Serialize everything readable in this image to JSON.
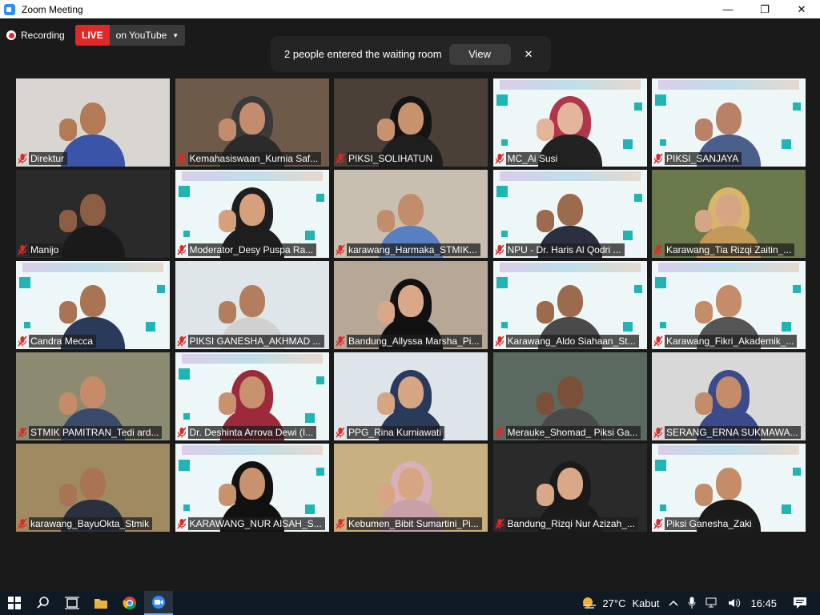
{
  "window": {
    "title": "Zoom Meeting",
    "minimize": "—",
    "maximize": "❐",
    "close": "✕"
  },
  "recording": {
    "label": "Recording"
  },
  "live": {
    "badge": "LIVE",
    "platform": "on YouTube"
  },
  "waiting_room": {
    "message": "2 people entered the waiting room",
    "view_label": "View",
    "close_label": "✕"
  },
  "participants": [
    {
      "name": "Direktur",
      "bg": "#d9d6d2",
      "banner": false,
      "skin": "#b27a55",
      "shirt": "#3a55a8",
      "hijab": ""
    },
    {
      "name": "Kemahasiswaan_Kurnia Saf...",
      "bg": "#6e5a48",
      "banner": false,
      "skin": "#c48c6e",
      "shirt": "#2b2b2b",
      "hijab": "#3a3a3a"
    },
    {
      "name": "PIKSI_SOLIHATUN",
      "bg": "#4a4038",
      "banner": false,
      "skin": "#c9926e",
      "shirt": "#1e1e1e",
      "hijab": "#141414"
    },
    {
      "name": "MC_Ai Susi",
      "bg": "#eef7f7",
      "banner": true,
      "skin": "#e4b59a",
      "shirt": "#222",
      "hijab": "#b0364c"
    },
    {
      "name": "PIKSI_SANJAYA",
      "bg": "#eef7f7",
      "banner": true,
      "skin": "#b98266",
      "shirt": "#4a5f8c",
      "hijab": ""
    },
    {
      "name": "Manijo",
      "bg": "#2a2a2a",
      "banner": false,
      "skin": "#8c5e44",
      "shirt": "#1a1a1a",
      "hijab": ""
    },
    {
      "name": "Moderator_Desy Puspa Ra...",
      "bg": "#eef7f7",
      "banner": true,
      "skin": "#d6a07c",
      "shirt": "#1e1e1e",
      "hijab": "#1e1e1e"
    },
    {
      "name": "karawang_Harmaka_STMIK...",
      "bg": "#c9bfb0",
      "banner": false,
      "skin": "#c28d6c",
      "shirt": "#5a7fc0",
      "hijab": ""
    },
    {
      "name": "NPU - Dr. Haris Al Qodri ...",
      "bg": "#eef7f7",
      "banner": true,
      "skin": "#9c6a4c",
      "shirt": "#2a3040",
      "hijab": ""
    },
    {
      "name": "Karawang_Tia Rizqi Zaitin_...",
      "bg": "#6a7a4c",
      "banner": false,
      "skin": "#d6a583",
      "shirt": "#c49a5a",
      "hijab": "#d9b56a"
    },
    {
      "name": "Candra Mecca",
      "bg": "#eef7f7",
      "banner": true,
      "skin": "#a87454",
      "shirt": "#2a3a5a",
      "hijab": ""
    },
    {
      "name": "PIKSI GANESHA_AKHMAD ...",
      "bg": "#dfe6ea",
      "banner": false,
      "skin": "#b27e5e",
      "shirt": "#d0d0d0",
      "hijab": ""
    },
    {
      "name": "Bandung_Allyssa Marsha_Pi...",
      "bg": "#b7a796",
      "banner": false,
      "skin": "#d9a888",
      "shirt": "#111",
      "hijab": "#111"
    },
    {
      "name": "Karawang_Aldo Siahaan_St...",
      "bg": "#eef7f7",
      "banner": true,
      "skin": "#9c6a4c",
      "shirt": "#4a4a4a",
      "hijab": ""
    },
    {
      "name": "Karawang_Fikri_Akademik_...",
      "bg": "#eef7f7",
      "banner": true,
      "skin": "#c48c68",
      "shirt": "#555",
      "hijab": ""
    },
    {
      "name": "STMIK PAMITRAN_Tedi ard...",
      "bg": "#8c8a70",
      "banner": false,
      "skin": "#c48c68",
      "shirt": "#3a4a6a",
      "hijab": ""
    },
    {
      "name": "Dr. Deshinta Arrova Dewi (I...",
      "bg": "#eef7f7",
      "banner": true,
      "skin": "#c9926e",
      "shirt": "#9c2a3a",
      "hijab": "#9c2a3a"
    },
    {
      "name": "PPG_Rina Kurniawati",
      "bg": "#dde4ea",
      "banner": false,
      "skin": "#d6a583",
      "shirt": "#2a3a5a",
      "hijab": "#2a3a5a"
    },
    {
      "name": "Merauke_Shomad_ Piksi Ga...",
      "bg": "#5a6a60",
      "banner": false,
      "skin": "#7a5038",
      "shirt": "#4a4a4a",
      "hijab": ""
    },
    {
      "name": "SERANG_ERNA SUKMAWA...",
      "bg": "#d8d8d8",
      "banner": false,
      "skin": "#c48c68",
      "shirt": "#3a4a8a",
      "hijab": "#3a4a8a"
    },
    {
      "name": "karawang_BayuOkta_Stmik",
      "bg": "#a08a62",
      "banner": false,
      "skin": "#a87454",
      "shirt": "#2a3040",
      "hijab": ""
    },
    {
      "name": "KARAWANG_NUR AISAH_S...",
      "bg": "#eef7f7",
      "banner": true,
      "skin": "#c9926e",
      "shirt": "#111",
      "hijab": "#111"
    },
    {
      "name": "Kebumen_Bibit Sumartini_Pi...",
      "bg": "#c8b080",
      "banner": false,
      "skin": "#d6a583",
      "shirt": "#c8a0a8",
      "hijab": "#d9b0b8"
    },
    {
      "name": "Bandung_Rizqi Nur Azizah_...",
      "bg": "#2a2a2a",
      "banner": false,
      "skin": "#d9a888",
      "shirt": "#1a1a1a",
      "hijab": "#1a1a1a"
    },
    {
      "name": "Piksi Ganesha_Zaki",
      "bg": "#eef7f7",
      "banner": true,
      "skin": "#c48c68",
      "shirt": "#1a1a1a",
      "hijab": ""
    }
  ],
  "tray": {
    "temperature": "27°C",
    "weather": "Kabut",
    "time": "16:45"
  }
}
